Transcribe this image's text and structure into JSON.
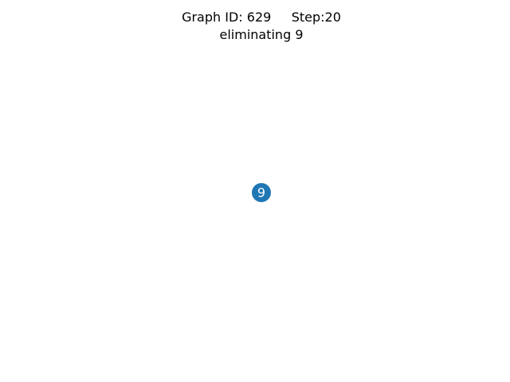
{
  "title": {
    "line1": "Graph ID: 629     Step:20",
    "line2": "eliminating 9"
  },
  "graph": {
    "nodes": [
      {
        "id": "9",
        "label": "9"
      }
    ],
    "edges": []
  },
  "colors": {
    "node_fill": "#1f77b4",
    "node_label": "#ffffff",
    "background": "#ffffff"
  }
}
